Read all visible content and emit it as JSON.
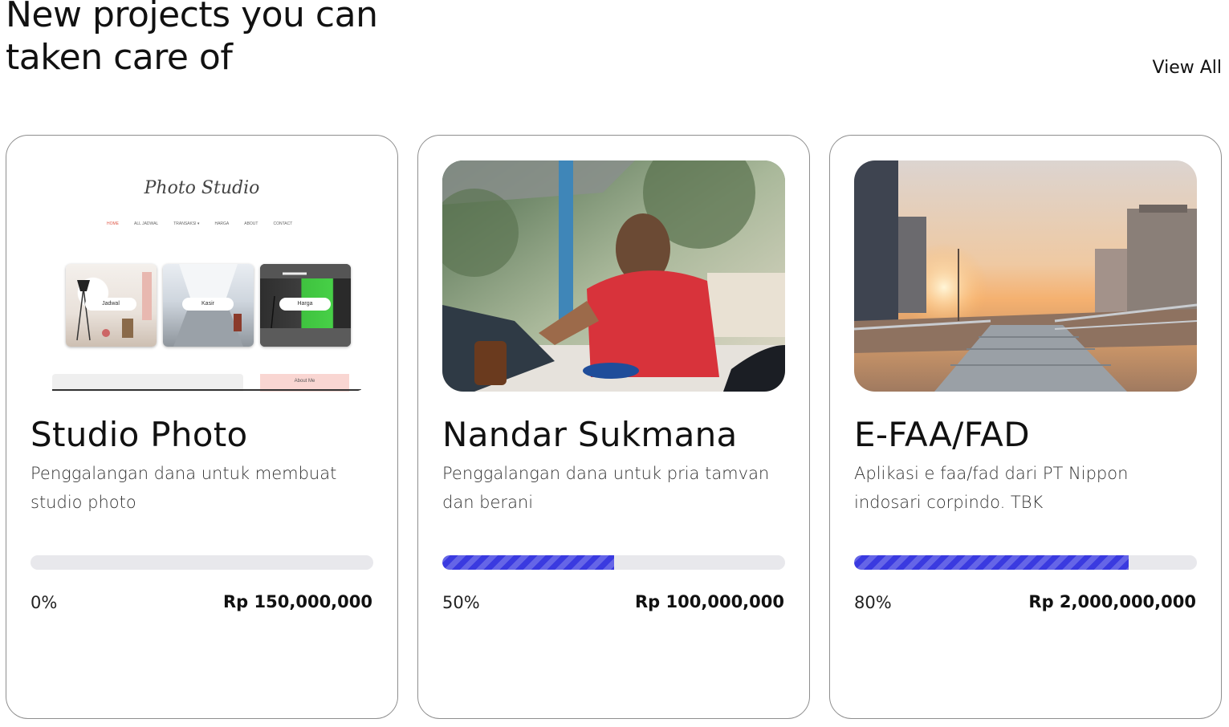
{
  "header": {
    "title": "New projects you can taken care of",
    "view_all_label": "View All"
  },
  "projects": [
    {
      "name": "Studio Photo",
      "description": "Penggalangan dana untuk membuat studio photo",
      "progress_percent": 0,
      "progress_label": "0%",
      "amount": "Rp 150,000,000",
      "image": {
        "kind": "website-mockup",
        "brand": "Photo Studio",
        "nav": [
          "HOME",
          "ALL JADWAL",
          "TRANSAKSI ▾",
          "HARGA",
          "ABOUT",
          "CONTACT"
        ],
        "tiles": [
          "Jadwal",
          "Kasir",
          "Harga"
        ],
        "footer_label": "About Me"
      }
    },
    {
      "name": "Nandar Sukmana",
      "description": "Penggalangan dana untuk pria tamvan dan berani",
      "progress_percent": 50,
      "progress_label": "50%",
      "amount": "Rp 100,000,000",
      "image": {
        "kind": "photo-man-with-laptop"
      }
    },
    {
      "name": "E-FAA/FAD",
      "description": "Aplikasi e faa/fad dari PT Nippon indosari corpindo. TBK",
      "progress_percent": 80,
      "progress_label": "80%",
      "amount": "Rp 2,000,000,000",
      "image": {
        "kind": "photo-city-stairs-sunset"
      }
    }
  ],
  "colors": {
    "progress_fill": "#3a3ae0",
    "progress_track": "#e8e8ec",
    "card_border": "#8e8e8e"
  }
}
